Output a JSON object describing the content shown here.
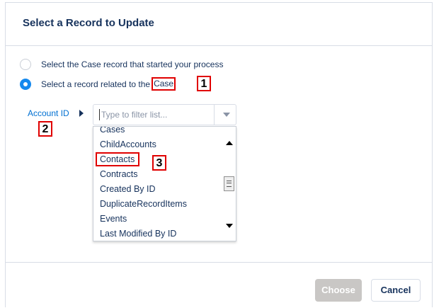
{
  "dialog": {
    "title": "Select a Record to Update"
  },
  "options": [
    {
      "label": "Select the Case record that started your process",
      "selected": false
    },
    {
      "label_prefix": "Select a record related to the",
      "label_object": "Case",
      "selected": true
    }
  ],
  "field": {
    "label": "Account ID",
    "placeholder": "Type to filter list..."
  },
  "dropdown": {
    "items": [
      "Cases",
      "ChildAccounts",
      "Contacts",
      "Contracts",
      "Created By ID",
      "DuplicateRecordItems",
      "Events",
      "Last Modified By ID"
    ]
  },
  "callouts": [
    "1",
    "2",
    "3"
  ],
  "footer": {
    "choose_label": "Choose",
    "cancel_label": "Cancel"
  },
  "colors": {
    "accent": "#1589ee",
    "link": "#0070d2",
    "text": "#16325c",
    "highlight": "#e00000",
    "disabled_button": "#c9c7c5"
  }
}
